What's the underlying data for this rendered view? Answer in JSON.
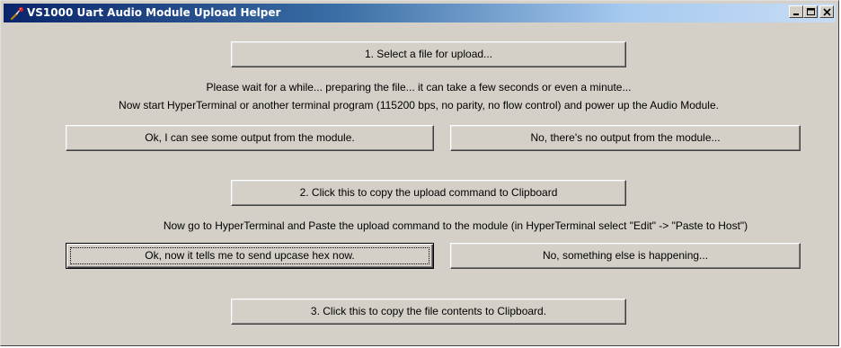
{
  "window": {
    "title": "VS1000 Uart Audio Module Upload Helper",
    "controls": {
      "minimize_icon": "minimize-icon",
      "maximize_icon": "maximize-icon",
      "close_icon": "close-icon"
    }
  },
  "step1": {
    "select_file_label": "1. Select a file for upload...",
    "wait_message": "Please wait for a while... preparing the file... it can take a few seconds or even a minute...",
    "start_message": "Now start HyperTerminal or another terminal program (115200 bps, no parity, no flow control) and power up the Audio Module.",
    "output_yes_label": "Ok, I can see some output from the module.",
    "output_no_label": "No, there's no output from the module..."
  },
  "step2": {
    "copy_command_label": "2. Click this to copy the upload command to Clipboard",
    "paste_message": "Now go to HyperTerminal and Paste the upload command to the module (in HyperTerminal select \"Edit\" -> \"Paste to Host\")",
    "hex_yes_label": "Ok, now it tells me to send upcase hex now.",
    "hex_no_label": "No, something else is happening..."
  },
  "step3": {
    "copy_contents_label": "3. Click this to copy the file contents to Clipboard."
  },
  "colors": {
    "title_gradient_start": "#0a246a",
    "title_gradient_end": "#c7dcf4",
    "face": "#d4d0c8"
  }
}
